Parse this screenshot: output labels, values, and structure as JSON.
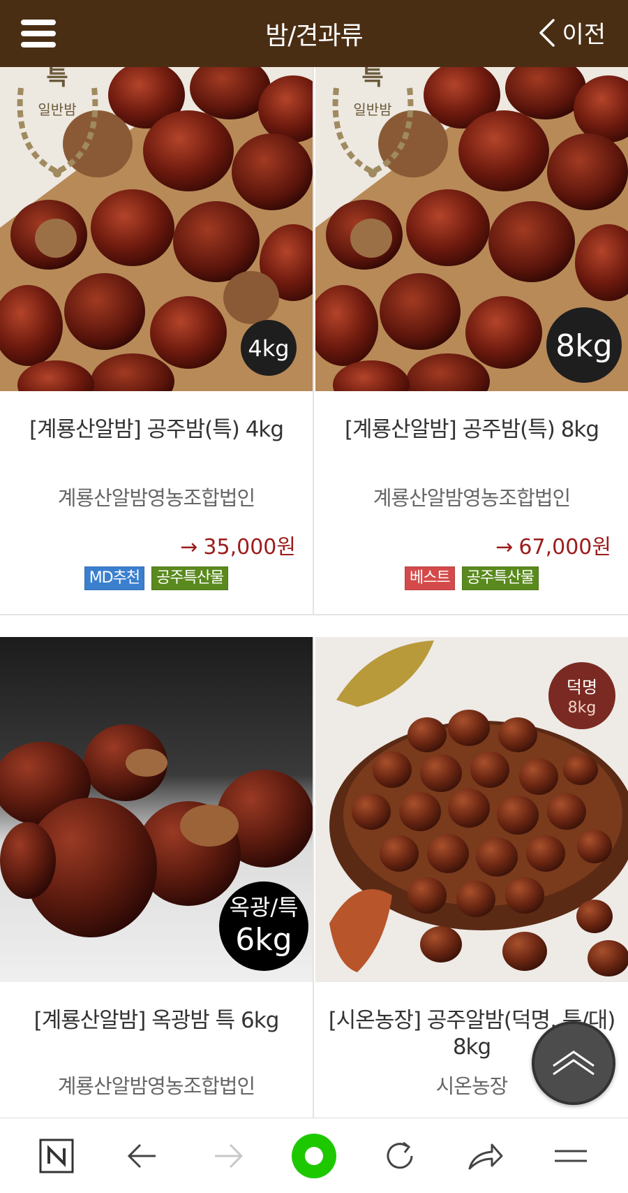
{
  "header": {
    "title": "밤/견과류",
    "back_label": "이전"
  },
  "products": [
    {
      "name": "[계룡산알밤] 공주밤(특) 4kg",
      "seller": "계룡산알밤영농조합법인",
      "price": "35,000원",
      "price_arrow": "→",
      "badge_text": "4kg",
      "grade_mark": "특",
      "grade_sub": "일반밤",
      "tags": [
        {
          "label": "MD추천",
          "color": "#3b7fcf"
        },
        {
          "label": "공주특산물",
          "color": "#5a8a1e"
        }
      ]
    },
    {
      "name": "[계룡산알밤] 공주밤(특) 8kg",
      "seller": "계룡산알밤영농조합법인",
      "price": "67,000원",
      "price_arrow": "→",
      "badge_text": "8kg",
      "grade_mark": "특",
      "grade_sub": "일반밤",
      "tags": [
        {
          "label": "베스트",
          "color": "#d44a4a"
        },
        {
          "label": "공주특산물",
          "color": "#5a8a1e"
        }
      ]
    },
    {
      "name": "[계룡산알밤] 옥광밤 특 6kg",
      "seller": "계룡산알밤영농조합법인",
      "badge_line1": "옥광/특",
      "badge_line2": "6kg"
    },
    {
      "name": "[시온농장] 공주알밤(덕명, 특/대) 8kg",
      "seller": "시온농장",
      "badge_line1": "덕명",
      "badge_line2": "8kg"
    }
  ],
  "toolbar": {
    "icons": [
      "naver-home-icon",
      "back-arrow-icon",
      "forward-arrow-icon",
      "green-dot-icon",
      "refresh-icon",
      "share-icon",
      "menu-icon"
    ]
  },
  "colors": {
    "header_bg": "#4a2e14",
    "price": "#9b1c1c",
    "green_dot": "#1ec800"
  }
}
